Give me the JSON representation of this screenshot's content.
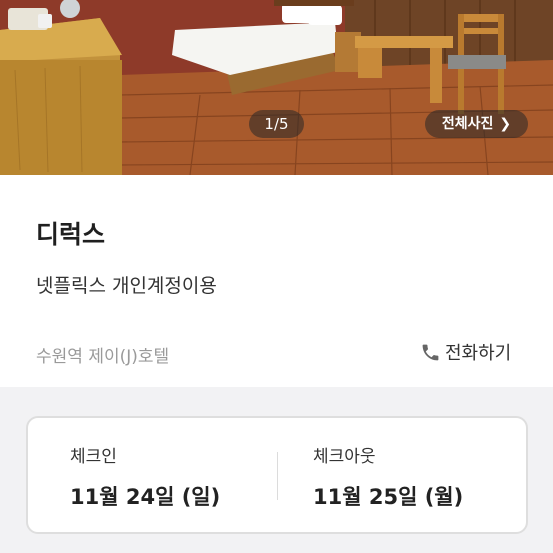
{
  "gallery": {
    "counter": "1/5",
    "all_photos_label": "전체사진",
    "chevron_icon": "chevron-right-icon"
  },
  "room": {
    "name": "디럭스",
    "description": "넷플릭스 개인계정이용",
    "hotel": "수원역 제이(J)호텔"
  },
  "contact": {
    "call_label": "전화하기",
    "call_icon": "phone-icon"
  },
  "stay": {
    "checkin_label": "체크인",
    "checkin_date": "11월 24일 (일)",
    "checkout_label": "체크아웃",
    "checkout_date": "11월 25일 (월)"
  }
}
